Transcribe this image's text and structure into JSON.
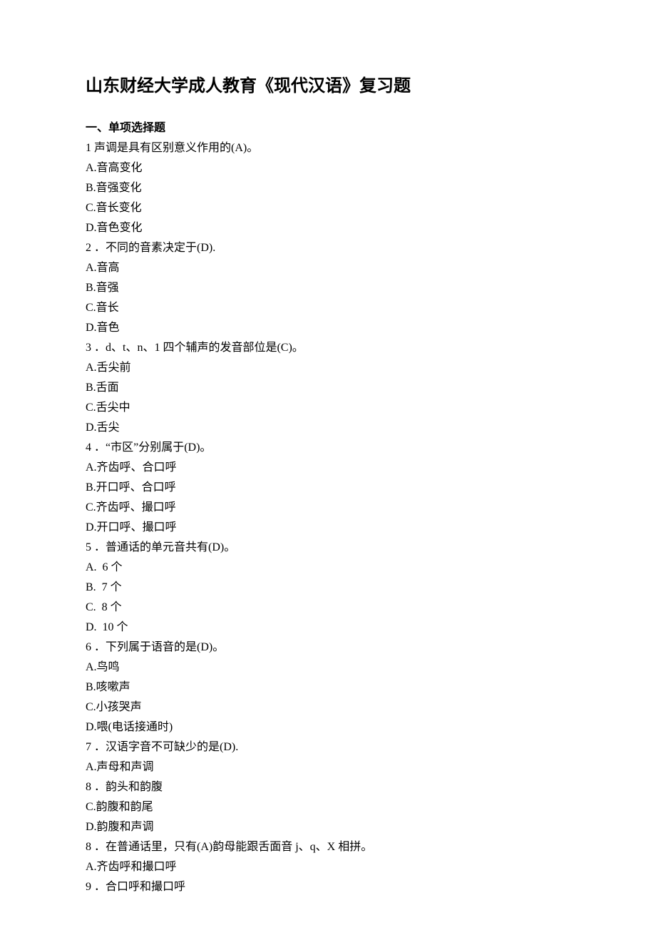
{
  "title": "山东财经大学成人教育《现代汉语》复习题",
  "section_header": "一、单项选择题",
  "lines": [
    "1 声调是具有区别意义作用的(A)。",
    "A.音高变化",
    "B.音强变化",
    "C.音长变化",
    "D.音色变化",
    "2 ．不同的音素决定于(D).",
    "A.音高",
    "B.音强",
    "C.音长",
    "D.音色",
    "3 ．d、t、n、1 四个辅声的发音部位是(C)。",
    "A.舌尖前",
    "B.舌面",
    "C.舌尖中",
    "D.舌尖",
    "4 ．“市区”分别属于(D)。",
    "A.齐齿呼、合口呼",
    "B.开口呼、合口呼",
    "C.齐齿呼、撮口呼",
    "D.开口呼、撮口呼",
    "5 ．普通话的单元音共有(D)。",
    "A.  6 个",
    "B.  7 个",
    "C.  8 个",
    "D.  10 个",
    "6 ．下列属于语音的是(D)。",
    "A.鸟鸣",
    "B.咳嗽声",
    "C.小孩哭声",
    "D.喂(电话接通时)",
    "7 ．汉语字音不可缺少的是(D).",
    "A.声母和声调",
    "8 ．韵头和韵腹",
    "C.韵腹和韵尾",
    "D.韵腹和声调",
    "8 ．在普通话里，只有(A)韵母能跟舌面音 j、q、X 相拼。",
    "A.齐齿呼和撮口呼",
    "9 ．合口呼和撮口呼"
  ]
}
